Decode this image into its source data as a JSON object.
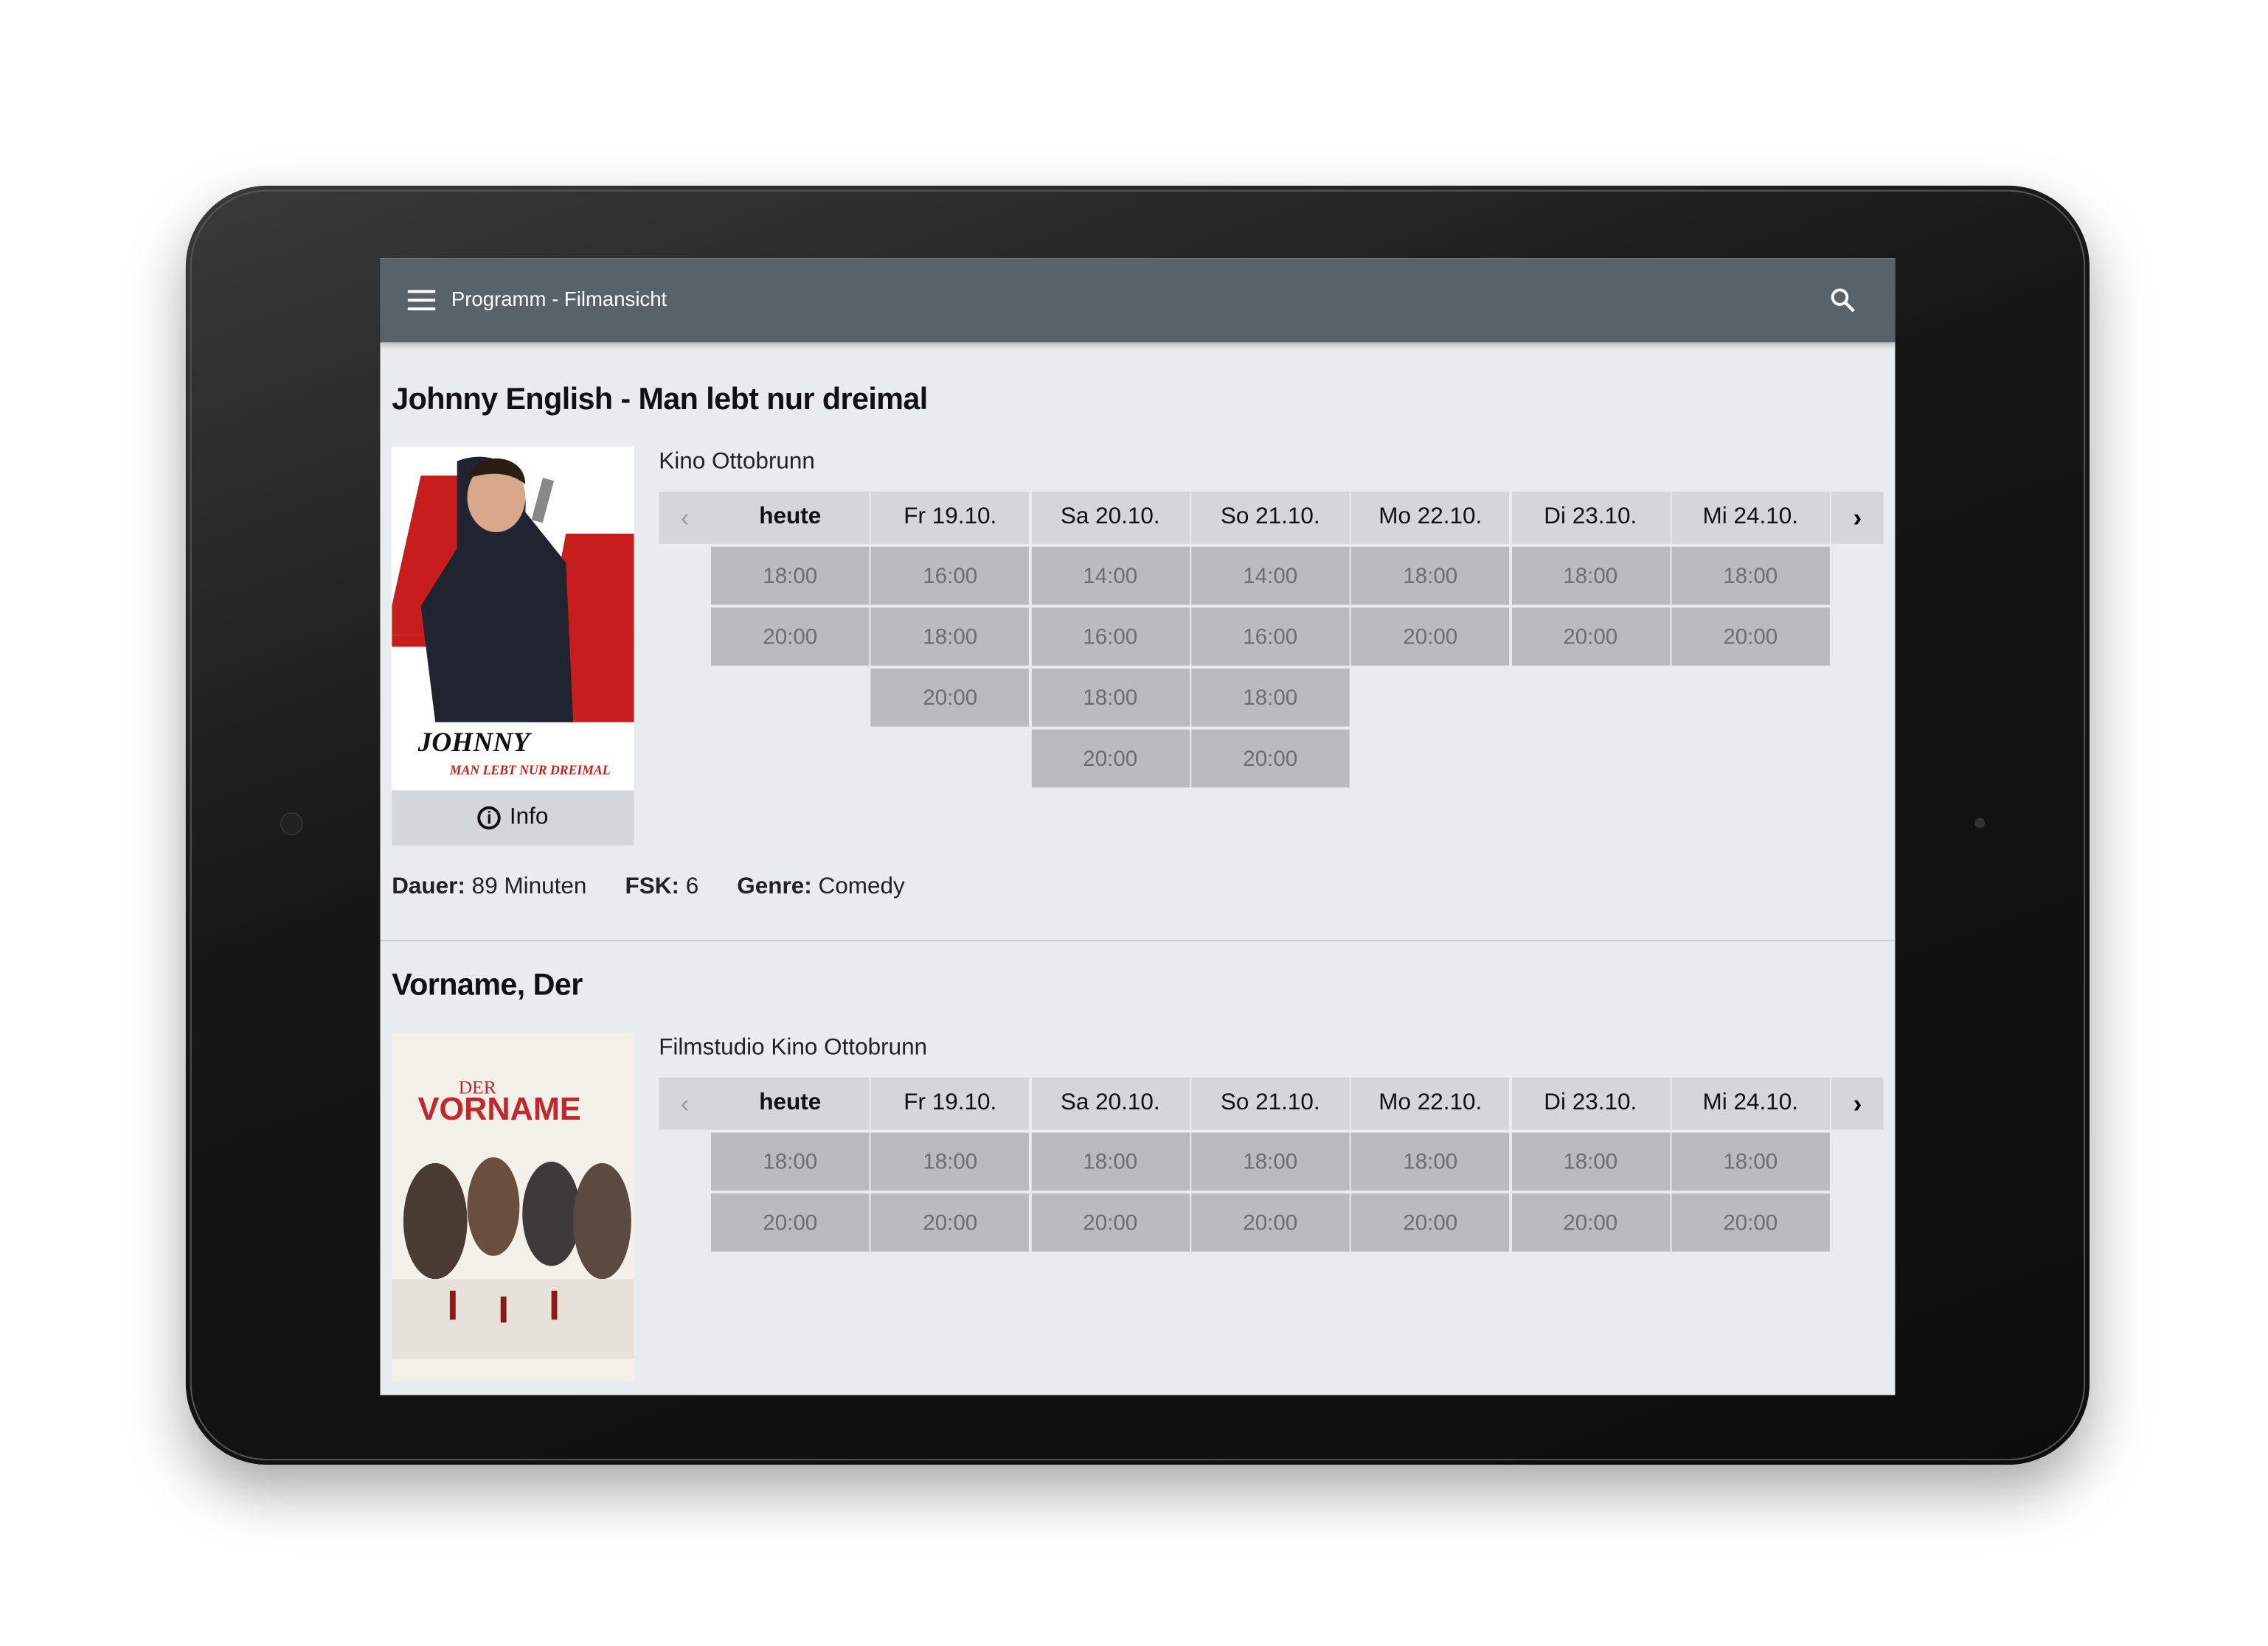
{
  "toolbar": {
    "title": "Programm - Filmansicht",
    "menu_icon": "hamburger-menu-icon",
    "search_icon": "search-icon"
  },
  "colors": {
    "toolbar": "#58626b",
    "background": "#e9ecef",
    "header_cell": "#d3d7da",
    "slot_cell": "#b8bcc1"
  },
  "movies": [
    {
      "title": "Johnny English - Man lebt nur dreimal",
      "poster_text": "JOHNNY ENGLISH MAN LEBT NUR DREIMAL",
      "info_label": "Info",
      "cinema": "Kino Ottobrunn",
      "days": [
        {
          "label": "heute",
          "times": [
            "18:00",
            "20:00"
          ]
        },
        {
          "label": "Fr 19.10.",
          "times": [
            "16:00",
            "18:00",
            "20:00"
          ]
        },
        {
          "label": "Sa 20.10.",
          "times": [
            "14:00",
            "16:00",
            "18:00",
            "20:00"
          ]
        },
        {
          "label": "So 21.10.",
          "times": [
            "14:00",
            "16:00",
            "18:00",
            "20:00"
          ]
        },
        {
          "label": "Mo 22.10.",
          "times": [
            "18:00",
            "20:00"
          ]
        },
        {
          "label": "Di 23.10.",
          "times": [
            "18:00",
            "20:00"
          ]
        },
        {
          "label": "Mi 24.10.",
          "times": [
            "18:00",
            "20:00"
          ]
        }
      ],
      "meta": {
        "duration_label": "Dauer:",
        "duration": "89 Minuten",
        "fsk_label": "FSK:",
        "fsk": "6",
        "genre_label": "Genre:",
        "genre": "Comedy"
      }
    },
    {
      "title": "Vorname, Der",
      "poster_text": "DER VORNAME",
      "cinema": "Filmstudio Kino Ottobrunn",
      "days": [
        {
          "label": "heute",
          "times": [
            "18:00",
            "20:00"
          ]
        },
        {
          "label": "Fr 19.10.",
          "times": [
            "18:00",
            "20:00"
          ]
        },
        {
          "label": "Sa 20.10.",
          "times": [
            "18:00",
            "20:00"
          ]
        },
        {
          "label": "So 21.10.",
          "times": [
            "18:00",
            "20:00"
          ]
        },
        {
          "label": "Mo 22.10.",
          "times": [
            "18:00",
            "20:00"
          ]
        },
        {
          "label": "Di 23.10.",
          "times": [
            "18:00",
            "20:00"
          ]
        },
        {
          "label": "Mi 24.10.",
          "times": [
            "18:00",
            "20:00"
          ]
        }
      ]
    }
  ]
}
